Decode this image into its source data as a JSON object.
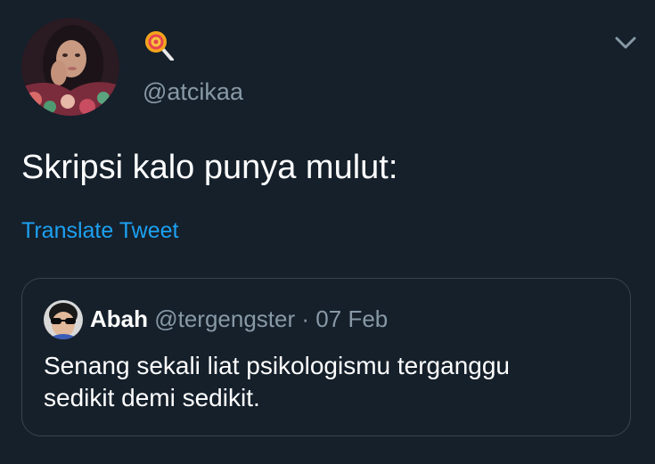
{
  "tweet": {
    "display_name_icon": "lollipop-emoji-icon",
    "handle": "@atcikaa",
    "text": "Skripsi kalo punya mulut:",
    "translate_label": "Translate Tweet",
    "menu_icon": "chevron-down-icon",
    "avatar_icon": "profile-photo"
  },
  "quoted_tweet": {
    "avatar_icon": "sunglasses-avatar",
    "name": "Abah",
    "handle": "@tergengster",
    "separator": "·",
    "date": "07 Feb",
    "text_line1": "Senang sekali liat psikologismu terganggu",
    "text_line2": "sedikit demi sedikit."
  },
  "colors": {
    "background": "#15202b",
    "text": "#ffffff",
    "secondary_text": "#8899a6",
    "link": "#1da1f2",
    "border": "#38444d"
  }
}
